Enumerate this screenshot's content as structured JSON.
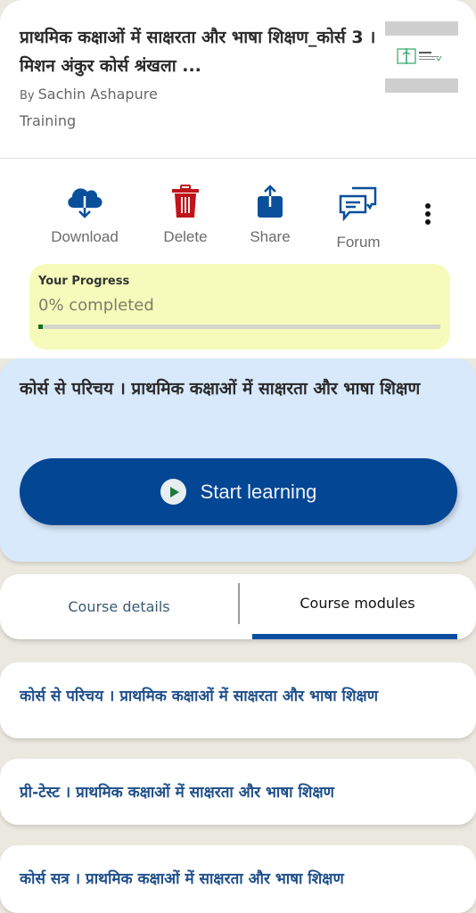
{
  "course": {
    "title": "प्राथमिक कक्षाओं में साक्षरता और भाषा शिक्षण_कोर्स 3 । मिशन अंकुर कोर्स श्रंखला ...",
    "author_prefix": "By",
    "author": "Sachin Ashapure",
    "category": "Training",
    "thumbnail_icon": "mission-ankur-logo"
  },
  "actions": [
    {
      "label": "Download",
      "icon": "cloud-download-icon",
      "color": "#0a4f9c"
    },
    {
      "label": "Delete",
      "icon": "trash-icon",
      "color": "#c0141b"
    },
    {
      "label": "Share",
      "icon": "share-icon",
      "color": "#0a4f9c"
    },
    {
      "label": "Forum",
      "icon": "forum-icon",
      "color": "#0a4f9c"
    }
  ],
  "more_icon": "more-vertical-icon",
  "progress": {
    "title": "Your Progress",
    "text": "0% completed",
    "percent": 0,
    "fill_color": "#1a6f1a"
  },
  "resume": {
    "title": "कोर्स से परिचय । प्राथमिक कक्षाओं में साक्षरता और भाषा शिक्षण",
    "button_label": "Start learning",
    "button_icon": "play-icon"
  },
  "tabs": [
    {
      "label": "Course details",
      "active": false
    },
    {
      "label": "Course modules",
      "active": true
    }
  ],
  "modules": [
    {
      "name": "कोर्स से परिचय । प्राथमिक कक्षाओं में साक्षरता और भाषा शिक्षण"
    },
    {
      "name": "प्री-टेस्ट । प्राथमिक कक्षाओं में साक्षरता और भाषा शिक्षण"
    },
    {
      "name": "कोर्स सत्र । प्राथमिक कक्षाओं में साक्षरता और भाषा शिक्षण"
    }
  ],
  "colors": {
    "brand_blue": "#034694",
    "progress_bg": "#f6fbbb",
    "resume_bg": "#d8e9fb",
    "page_bg": "#ebe9df"
  }
}
